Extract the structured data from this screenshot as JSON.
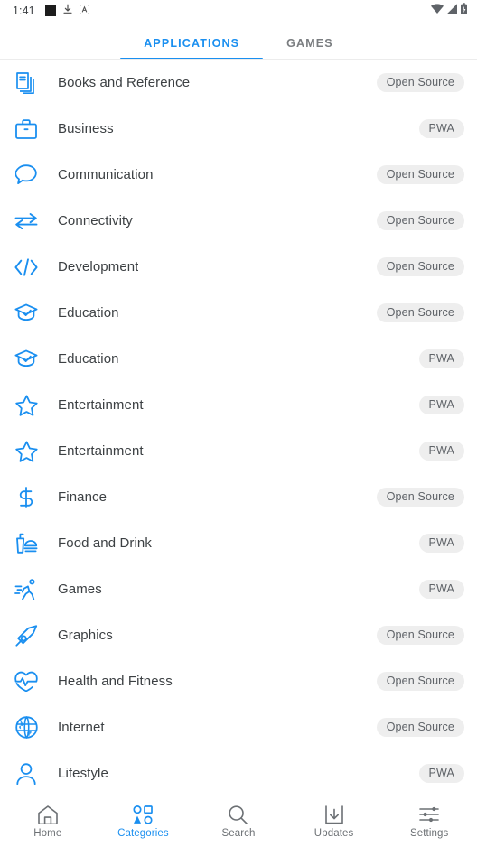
{
  "status_bar": {
    "time": "1:41",
    "left_icons": [
      "black-square-icon",
      "download-icon",
      "app-badge-icon"
    ],
    "right_icons": [
      "wifi-icon",
      "cellular-signal-icon",
      "battery-icon"
    ]
  },
  "tabs": [
    {
      "label": "APPLICATIONS",
      "active": true
    },
    {
      "label": "GAMES",
      "active": false
    }
  ],
  "colors": {
    "accent": "#1a8ff0",
    "text_primary": "#3c4043",
    "text_secondary": "#6c7074",
    "badge_bg": "#eeeeee",
    "badge_text": "#5f6368"
  },
  "categories": [
    {
      "label": "Books and Reference",
      "badge": "Open Source",
      "icon": "books-icon"
    },
    {
      "label": "Business",
      "badge": "PWA",
      "icon": "briefcase-icon"
    },
    {
      "label": "Communication",
      "badge": "Open Source",
      "icon": "chat-bubble-icon"
    },
    {
      "label": "Connectivity",
      "badge": "Open Source",
      "icon": "exchange-arrows-icon"
    },
    {
      "label": "Development",
      "badge": "Open Source",
      "icon": "code-brackets-icon"
    },
    {
      "label": "Education",
      "badge": "Open Source",
      "icon": "graduation-cap-icon"
    },
    {
      "label": "Education",
      "badge": "PWA",
      "icon": "graduation-cap-icon"
    },
    {
      "label": "Entertainment",
      "badge": "PWA",
      "icon": "star-icon"
    },
    {
      "label": "Entertainment",
      "badge": "PWA",
      "icon": "star-icon"
    },
    {
      "label": "Finance",
      "badge": "Open Source",
      "icon": "dollar-sign-icon"
    },
    {
      "label": "Food and Drink",
      "badge": "PWA",
      "icon": "food-drink-icon"
    },
    {
      "label": "Games",
      "badge": "PWA",
      "icon": "runner-icon"
    },
    {
      "label": "Graphics",
      "badge": "Open Source",
      "icon": "pen-nib-icon"
    },
    {
      "label": "Health and Fitness",
      "badge": "Open Source",
      "icon": "heartbeat-icon"
    },
    {
      "label": "Internet",
      "badge": "Open Source",
      "icon": "globe-icon"
    },
    {
      "label": "Lifestyle",
      "badge": "PWA",
      "icon": "person-icon"
    }
  ],
  "bottom_nav": [
    {
      "label": "Home",
      "icon": "home-icon",
      "active": false
    },
    {
      "label": "Categories",
      "icon": "categories-icon",
      "active": true
    },
    {
      "label": "Search",
      "icon": "search-icon",
      "active": false
    },
    {
      "label": "Updates",
      "icon": "download-box-icon",
      "active": false
    },
    {
      "label": "Settings",
      "icon": "sliders-icon",
      "active": false
    }
  ]
}
